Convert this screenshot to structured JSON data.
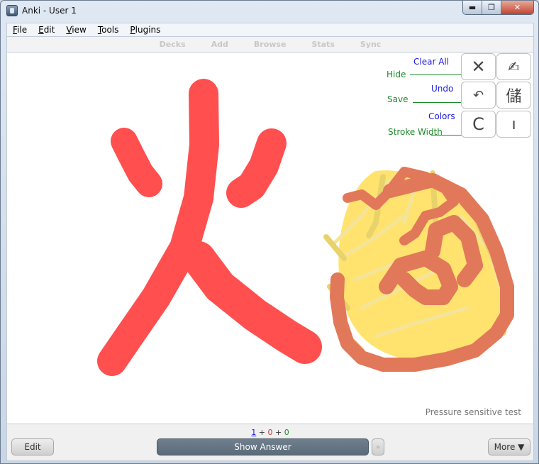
{
  "window": {
    "title": "Anki - User 1",
    "controls": {
      "minimize": "▬",
      "maximize": "❐",
      "close": "✕"
    }
  },
  "menu": {
    "items": [
      {
        "key": "F",
        "rest": "ile"
      },
      {
        "key": "E",
        "rest": "dit"
      },
      {
        "key": "V",
        "rest": "iew"
      },
      {
        "key": "T",
        "rest": "ools"
      },
      {
        "key": "P",
        "rest": "lugins"
      }
    ]
  },
  "toolbar": {
    "decks": "Decks",
    "add": "Add",
    "browse": "Browse",
    "stats": "Stats",
    "sync": "Sync"
  },
  "drawing_controls": {
    "clear_all": "Clear All",
    "hide": "Hide",
    "undo": "Undo",
    "save": "Save",
    "colors": "Colors",
    "stroke_width": "Stroke Width",
    "buttons": {
      "clear": "✕",
      "pen": "✍",
      "undo": "↶",
      "kanji": "儲",
      "colors": "C",
      "stroke": "ı"
    }
  },
  "card": {
    "pressure_text": "Pressure sensitive test",
    "stroke_colors": {
      "red": "#ff4f4f",
      "yellow": "#ffe36e",
      "ochre": "#e8d36a",
      "orange": "#e2785a"
    }
  },
  "review": {
    "counts": {
      "new": "1",
      "plus1": " + ",
      "learn": "0",
      "plus2": " + ",
      "review": "0"
    },
    "edit": "Edit",
    "show_answer": "Show Answer",
    "skip": "»",
    "more": "More ▼"
  }
}
